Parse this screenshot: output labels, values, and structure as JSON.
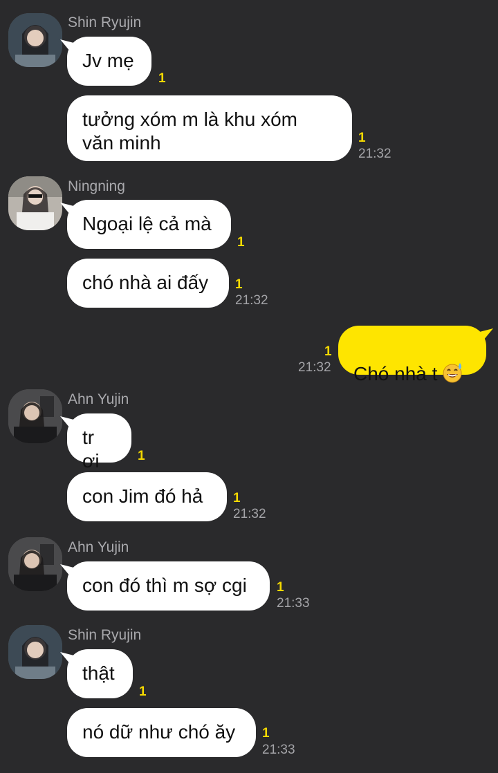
{
  "messages": [
    {
      "sender": "Shin Ryujin",
      "text": "Jv mẹ",
      "unread": "1",
      "time": ""
    },
    {
      "sender": "",
      "text": "tưởng xóm m là khu xóm\nvăn minh",
      "unread": "1",
      "time": "21:32"
    },
    {
      "sender": "Ningning",
      "text": "Ngoại lệ cả mà",
      "unread": "1",
      "time": ""
    },
    {
      "sender": "",
      "text": "chó nhà ai đấy",
      "unread": "1",
      "time": "21:32"
    },
    {
      "sender": "me",
      "text": "Chó nhà t",
      "emoji": "sweat-smile-emoji",
      "unread": "1",
      "time": "21:32"
    },
    {
      "sender": "Ahn Yujin",
      "text": "tr ơi",
      "unread": "1",
      "time": ""
    },
    {
      "sender": "",
      "text": "con Jim đó hả",
      "unread": "1",
      "time": "21:32"
    },
    {
      "sender": "Ahn Yujin",
      "text": "con đó thì m sợ cgi",
      "unread": "1",
      "time": "21:33"
    },
    {
      "sender": "Shin Ryujin",
      "text": "thật",
      "unread": "1",
      "time": ""
    },
    {
      "sender": "",
      "text": "nó dữ như chó ăy",
      "unread": "1",
      "time": "21:33"
    }
  ],
  "colors": {
    "background": "#2a2a2c",
    "incoming_bubble": "#ffffff",
    "outgoing_bubble": "#fee500",
    "unread": "#f5d900"
  }
}
